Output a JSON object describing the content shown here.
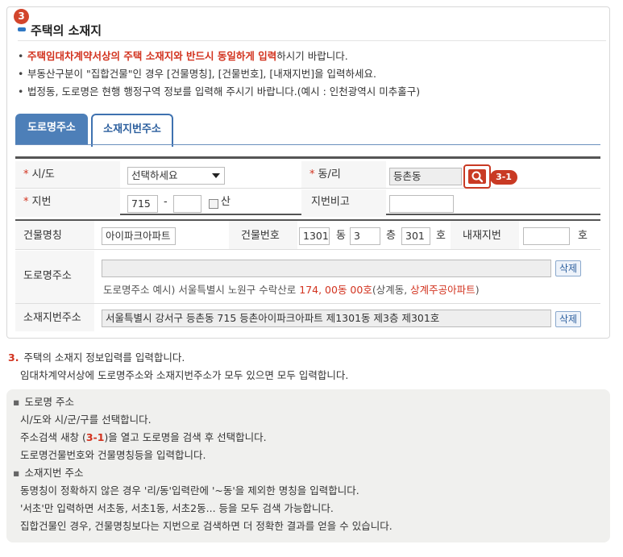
{
  "section": {
    "badge": "3",
    "title": "주택의 소재지"
  },
  "notes": [
    {
      "red": "주택임대차계약서상의 주택 소재지와 반드시 동일하게 입력",
      "rest": "하시기 바랍니다."
    },
    {
      "red": "",
      "rest": "부동산구분이 \"집합건물\"인 경우 [건물명칭], [건물번호], [내재지번]을 입력하세요."
    },
    {
      "red": "",
      "rest": "법정동, 도로명은 현행 행정구역 정보를 입력해 주시기 바랍니다.(예시 : 인천광역시 미추홀구)"
    }
  ],
  "tabs": {
    "road": "도로명주소",
    "lot": "소재지번주소"
  },
  "form": {
    "sido_label": "시/도",
    "sido_value": "선택하세요",
    "dong_label": "동/리",
    "dong_value": "등촌동",
    "callout": "3-1",
    "jibun_label": "지번",
    "jibun_main": "715",
    "jibun_dash": "-",
    "jibun_sub": "",
    "san_label": "산",
    "jibun_note_label": "지번비고",
    "jibun_note_value": "",
    "required_mark": "*"
  },
  "detail": {
    "bldg_name_label": "건물명칭",
    "bldg_name_value": "아이파크아파트",
    "bldg_no_label": "건물번호",
    "bldg_no_value": "1301",
    "dong_unit": "동",
    "floor_value": "3",
    "floor_unit": "층",
    "ho_value": "301",
    "ho_unit": "호",
    "inner_jibun_label": "내재지번",
    "inner_jibun_value": "",
    "inner_ho_unit": "호",
    "road_addr_label": "도로명주소",
    "road_addr_value": "",
    "delete_label": "삭제",
    "road_example_prefix": "도로명주소 예시) 서울특별시 노원구 수락산로 ",
    "road_example_num": "174, 00동 00호",
    "road_example_mid": "(상계동, ",
    "road_example_apt": "상계주공아파트",
    "road_example_end": ")",
    "lot_addr_label": "소재지번주소",
    "lot_addr_value": "서울특별시 강서구 등촌동  715 등촌아이파크아파트 제1301동 제3층 제301호",
    "delete_label2": "삭제"
  },
  "desc": {
    "num": "3.",
    "line1": "주택의 소재지 정보입력를 입력합니다.",
    "line2": "임대차계약서상에 도로명주소와 소재지번주소가 모두 있으면 모두 입력합니다."
  },
  "guide": {
    "bullet": "▪",
    "road_title": "도로명 주소",
    "road_1": "시/도와 시/군/구를 선택합니다.",
    "road_2a": "주소검색 새창 (",
    "road_2ref": "3-1",
    "road_2b": ")을 열고 도로명을 검색 후 선택합니다.",
    "road_3": "도로명건물번호와 건물명칭등을 입력합니다.",
    "lot_title": "소재지번 주소",
    "lot_1": "동명칭이 정확하지 않은 경우 '리/동'입력란에 '~동'을 제외한 명칭을 입력합니다.",
    "lot_2": "'서초'만 입력하면 서초동, 서초1동, 서초2동... 등을 모두 검색 가능합니다.",
    "lot_3": "집합건물인 경우, 건물명칭보다는 지번으로 검색하면 더 정확한 결과를 얻을 수 있습니다."
  },
  "colors": {
    "accent_red": "#d2331f",
    "tab_blue": "#4d7fb8"
  }
}
